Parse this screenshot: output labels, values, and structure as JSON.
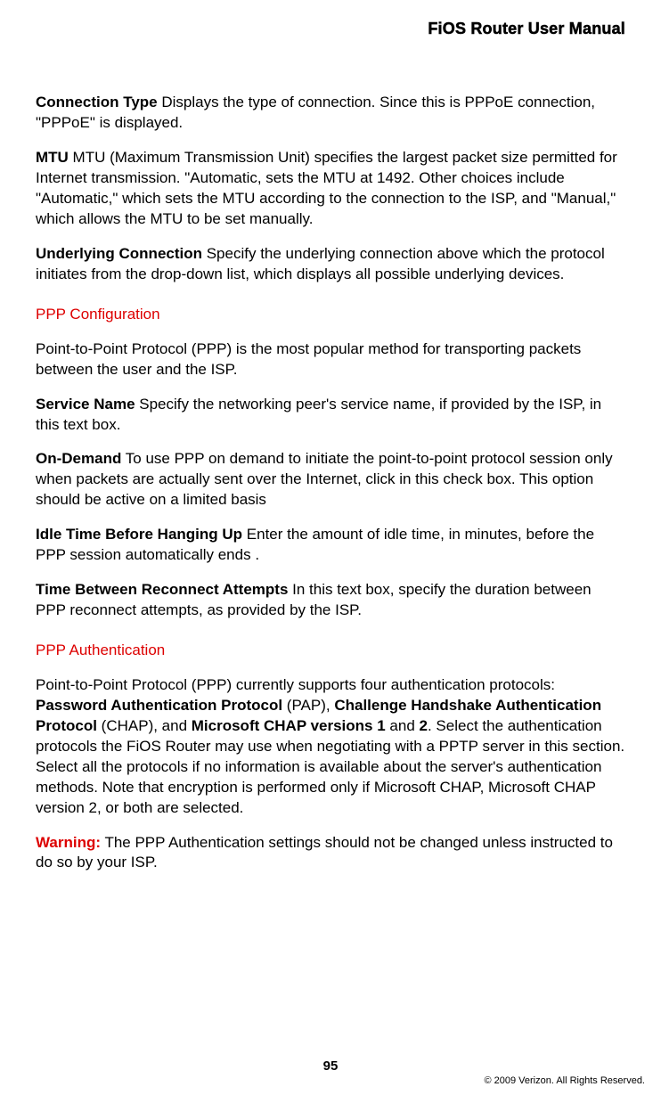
{
  "header": {
    "title": "FiOS Router User Manual"
  },
  "paragraphs": {
    "connType_term": "Connection Type",
    "connType_text": "  Displays the type of connection. Since this is PPPoE connection, \"PPPoE\" is displayed.",
    "mtu_term": "MTU",
    "mtu_text": "  MTU (Maximum Transmission Unit) specifies the largest packet size permitted for Internet transmission. \"Automatic, sets the MTU at 1492. Other choices include \"Automatic,\" which sets the MTU according to the connection to the ISP, and \"Manual,\" which allows the MTU to be set manually.",
    "underlying_term": "Underlying Connection",
    "underlying_text": "  Specify the underlying connection above which the protocol initiates from the drop-down list, which displays all possible underlying devices.",
    "pppConfigHeading": "PPP Configuration",
    "pppConfigIntro": "Point-to-Point Protocol (PPP) is the most popular method for transporting packets between the user and the ISP.",
    "serviceName_term": "Service Name",
    "serviceName_text": "  Specify the networking peer's service name, if provided by the ISP, in this text box.",
    "onDemand_term": "On-Demand",
    "onDemand_text": "  To use PPP on demand to initiate the point-to-point protocol session only when packets are actually sent over the Internet, click in this check box. This option should be active on a limited basis",
    "idleTime_term": "Idle Time Before Hanging Up",
    "idleTime_text": "  Enter the amount of idle time, in minutes, before the PPP session automatically ends .",
    "reconnect_term": "Time Between Reconnect Attempts",
    "reconnect_text": "  In this text box, specify the duration between PPP reconnect attempts, as provided by the ISP.",
    "pppAuthHeading": "PPP Authentication",
    "pppAuth_before": "Point-to-Point Protocol (PPP) currently supports four authentication protocols: ",
    "pppAuth_pap": "Password Authentication Protocol",
    "pppAuth_pap_after": " (PAP), ",
    "pppAuth_chap": "Challenge Handshake Authentication Protocol",
    "pppAuth_chap_after": " (CHAP), and ",
    "pppAuth_mschap": "Microsoft CHAP versions 1",
    "pppAuth_and": " and ",
    "pppAuth_two": "2",
    "pppAuth_rest": ". Select the authentication protocols the FiOS Router may use when negotiating with a PPTP server in this section. Select all the protocols if no information is available about the server's authentication methods. Note that encryption is performed only if Microsoft CHAP, Microsoft CHAP version 2, or both are selected.",
    "warning_label": "Warning:",
    "warning_text": " The PPP Authentication settings should not be changed unless instructed to do so by your ISP."
  },
  "footer": {
    "page": "95",
    "copyright": "© 2009 Verizon. All Rights Reserved."
  }
}
